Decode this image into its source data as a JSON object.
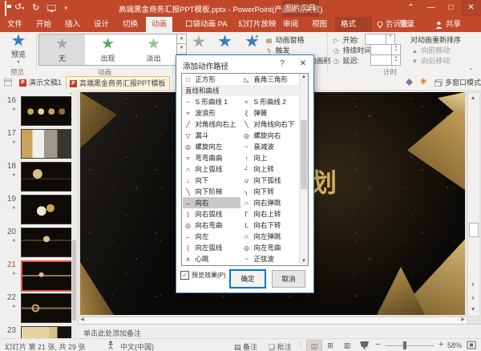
{
  "titlebar": {
    "title": "高端黑金商务汇报PPT模板.pptx - PowerPoint(产品激活失败)",
    "context_tool": "图片工具"
  },
  "tabs": {
    "items": [
      "文件",
      "开始",
      "插入",
      "设计",
      "切换",
      "动画",
      "口袋动画 PA",
      "幻灯片放映",
      "审阅",
      "视图",
      "格式"
    ],
    "tell_me": "告诉我...",
    "sign_in": "登录",
    "share": "共享"
  },
  "ribbon": {
    "preview_button": "预览",
    "group_preview": "预览",
    "group_animation": "动画",
    "group_timing": "计时",
    "gallery": [
      {
        "label": "无"
      },
      {
        "label": "出现"
      },
      {
        "label": "淡出"
      }
    ],
    "animation_pane": "动画窗格",
    "trigger": "触发",
    "painter": "动画刷",
    "start_label": "开始:",
    "duration_label": "持续时间:",
    "delay_label": "延迟:",
    "reorder_label": "对动画重新排序",
    "move_earlier": "向前移动",
    "move_later": "向后移动"
  },
  "doctabs": {
    "tab1": "演示文稿1",
    "tab2": "高端黑金商务汇报PPT模板",
    "multi_window": "多窗口模式"
  },
  "panel": {
    "slides": [
      {
        "num": "16"
      },
      {
        "num": "17"
      },
      {
        "num": "18"
      },
      {
        "num": "19"
      },
      {
        "num": "20"
      },
      {
        "num": "21",
        "selected": true
      },
      {
        "num": "22"
      },
      {
        "num": "23"
      }
    ]
  },
  "dialog": {
    "title": "添加动作路径",
    "top_row": {
      "l_icon": "□",
      "l_label": "正方形",
      "r_icon": "◺",
      "r_label": "直角三角形"
    },
    "section": "直线和曲线",
    "rows": [
      {
        "li": "~",
        "ll": "S 形曲线 1",
        "ri": "≈",
        "rl": "S 形曲线 2"
      },
      {
        "li": "≈",
        "ll": "波浪形",
        "ri": "ξ",
        "rl": "弹簧"
      },
      {
        "li": "╱",
        "ll": "对角线向右上",
        "ri": "╲",
        "rl": "对角线向右下"
      },
      {
        "li": "▽",
        "ll": "漏斗",
        "ri": "◎",
        "rl": "螺旋向右"
      },
      {
        "li": "◎",
        "ll": "螺旋向左",
        "ri": "~",
        "rl": "衰减波"
      },
      {
        "li": "≈",
        "ll": "弯弯曲曲",
        "ri": "↑",
        "rl": "向上"
      },
      {
        "li": "∩",
        "ll": "向上弧线",
        "ri": "┘",
        "rl": "向上转"
      },
      {
        "li": "↓",
        "ll": "向下",
        "ri": "∪",
        "rl": "向下弧线"
      },
      {
        "li": "╲",
        "ll": "向下阶梯",
        "ri": "┐",
        "rl": "向下转"
      },
      {
        "li": "→",
        "ll": "向右",
        "ri": "∩",
        "rl": "向右弹跳",
        "selected": true
      },
      {
        "li": ")",
        "ll": "向右弧线",
        "ri": "Γ",
        "rl": "向右上转"
      },
      {
        "li": "◎",
        "ll": "向右弯曲",
        "ri": "L",
        "rl": "向右下转"
      },
      {
        "li": "←",
        "ll": "向左",
        "ri": "∩",
        "rl": "向左弹跳"
      },
      {
        "li": "(",
        "ll": "向左弧线",
        "ri": "◎",
        "rl": "向左弯曲"
      },
      {
        "li": "ʌ",
        "ll": "心跳",
        "ri": "~",
        "rl": "正弦波"
      }
    ],
    "preview_check": "预览效果(P)",
    "ok": "确定",
    "cancel": "取消"
  },
  "slide": {
    "big_char": "划"
  },
  "notes": {
    "placeholder": "单击此处添加备注"
  },
  "status": {
    "slide_info": "幻灯片 第 21 张, 共 29 张",
    "language": "中文(中国)",
    "notes_btn": "备注",
    "comments_btn": "批注",
    "zoom_level": "58%"
  },
  "colors": {
    "accent_red": "#C0492C",
    "gold": "#C9A35B",
    "selection_orange": "#E4573D",
    "dialog_border": "#3C7FB1",
    "star_green": "#57A75A",
    "star_blue": "#3E7CBF"
  }
}
